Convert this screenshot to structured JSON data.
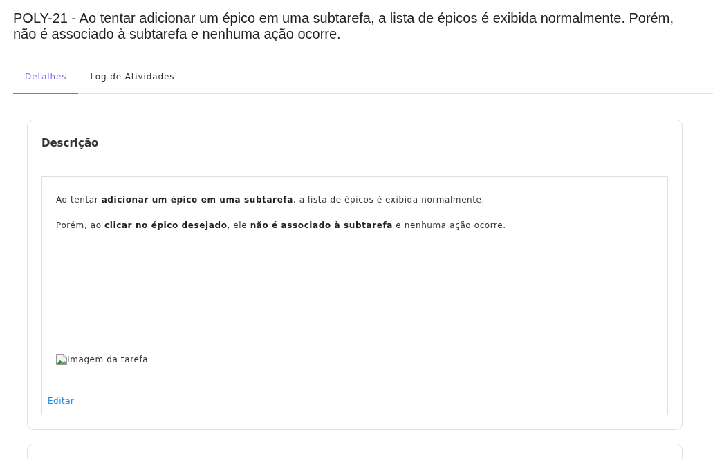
{
  "issue": {
    "title_lines": [
      "POLY-21 - Ao tentar adicionar um épico em uma subtarefa, a lista de épicos é exibida normalmente. Porém,",
      "não é associado à subtarefa e nenhuma ação ocorre."
    ]
  },
  "tabs": [
    {
      "label": "Detalhes",
      "selected": true
    },
    {
      "label": "Log de Atividades",
      "selected": false
    }
  ],
  "description": {
    "heading": "Descrição",
    "paragraphs": [
      "Ao tentar **adicionar um épico em uma subtarefa**, a lista de épicos é exibida normalmente.",
      "Porém, ao **clicar no épico desejado**, ele **não é associado à subtarefa** e nenhuma ação ocorre."
    ],
    "image_alt": "Imagem da tarefa",
    "edit_link": "Editar"
  }
}
